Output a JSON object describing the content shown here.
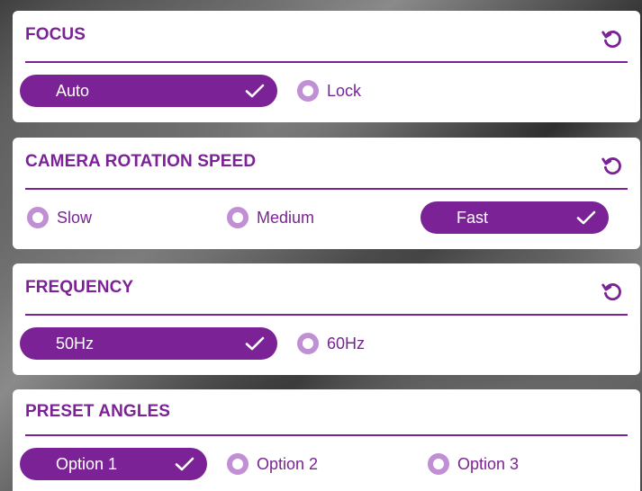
{
  "colors": {
    "accent": "#7b2396",
    "radio_ring": "#c08fd4",
    "panel_bg": "#ffffff"
  },
  "panels": [
    {
      "title": "FOCUS",
      "reset_icon": "reset-icon",
      "options": [
        {
          "label": "Auto",
          "selected": true
        },
        {
          "label": "Lock",
          "selected": false
        }
      ]
    },
    {
      "title": "CAMERA ROTATION SPEED",
      "reset_icon": "reset-icon",
      "options": [
        {
          "label": "Slow",
          "selected": false
        },
        {
          "label": "Medium",
          "selected": false
        },
        {
          "label": "Fast",
          "selected": true
        }
      ]
    },
    {
      "title": "FREQUENCY",
      "reset_icon": "reset-icon",
      "options": [
        {
          "label": "50Hz",
          "selected": true
        },
        {
          "label": "60Hz",
          "selected": false
        }
      ]
    },
    {
      "title": "PRESET ANGLES",
      "options": [
        {
          "label": "Option 1",
          "selected": true
        },
        {
          "label": "Option 2",
          "selected": false
        },
        {
          "label": "Option 3",
          "selected": false
        }
      ]
    }
  ]
}
